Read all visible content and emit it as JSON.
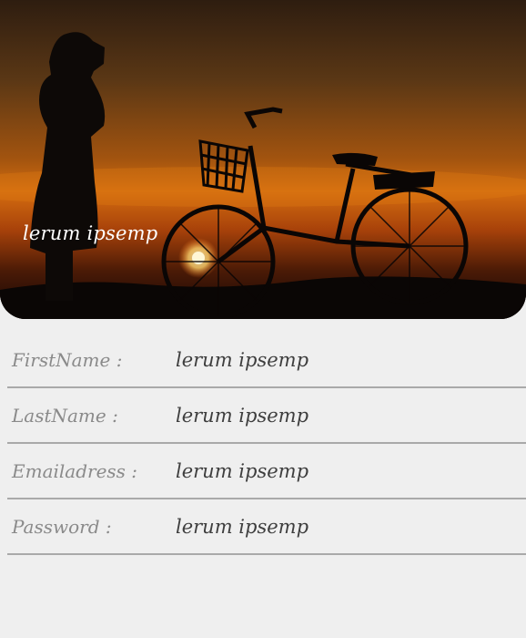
{
  "hero": {
    "caption": "lerum ipsemp",
    "image_subject": "silhouette of photographer and bicycle at sunset"
  },
  "form": {
    "rows": [
      {
        "label": "FirstName :",
        "value": "lerum ipsemp"
      },
      {
        "label": "LastName :",
        "value": "lerum ipsemp"
      },
      {
        "label": "Emailadress :",
        "value": "lerum ipsemp"
      },
      {
        "label": "Password :",
        "value": "lerum ipsemp"
      }
    ]
  },
  "colors": {
    "background": "#efefef",
    "divider": "#a9a9a9",
    "label": "#8a8a8a",
    "value": "#3e3e3e",
    "sky_top": "#3a2410",
    "sky_glow": "#c8640f"
  }
}
